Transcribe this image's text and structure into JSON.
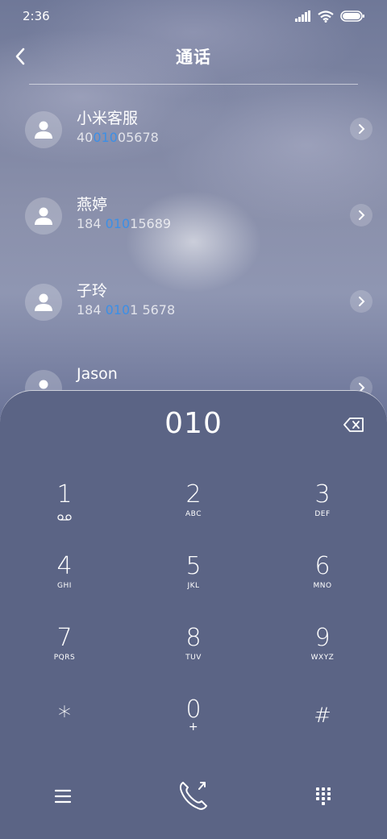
{
  "status": {
    "time": "2:36"
  },
  "header": {
    "title": "通话",
    "back_icon": "back-arrow-icon"
  },
  "contacts": [
    {
      "name": "小米客服",
      "num_pre": "40",
      "num_hl": "010",
      "num_post": "05678"
    },
    {
      "name": "燕婷",
      "num_pre": "184 ",
      "num_hl": "010",
      "num_post": "15689"
    },
    {
      "name": "子玲",
      "num_pre": "184 ",
      "num_hl": "010",
      "num_post": "1 5678"
    },
    {
      "name": "Jason",
      "num_pre": "",
      "num_hl": "",
      "num_post": ""
    }
  ],
  "dialpad": {
    "typed": "010",
    "keys": [
      {
        "digit": "1",
        "letters": ""
      },
      {
        "digit": "2",
        "letters": "ABC"
      },
      {
        "digit": "3",
        "letters": "DEF"
      },
      {
        "digit": "4",
        "letters": "GHI"
      },
      {
        "digit": "5",
        "letters": "JKL"
      },
      {
        "digit": "6",
        "letters": "MNO"
      },
      {
        "digit": "7",
        "letters": "PQRS"
      },
      {
        "digit": "8",
        "letters": "TUV"
      },
      {
        "digit": "9",
        "letters": "WXYZ"
      },
      {
        "digit": "*",
        "letters": ""
      },
      {
        "digit": "0",
        "letters": "+"
      },
      {
        "digit": "#",
        "letters": ""
      }
    ]
  },
  "colors": {
    "highlight": "#3c8fe6",
    "panel": "#5b6485"
  }
}
